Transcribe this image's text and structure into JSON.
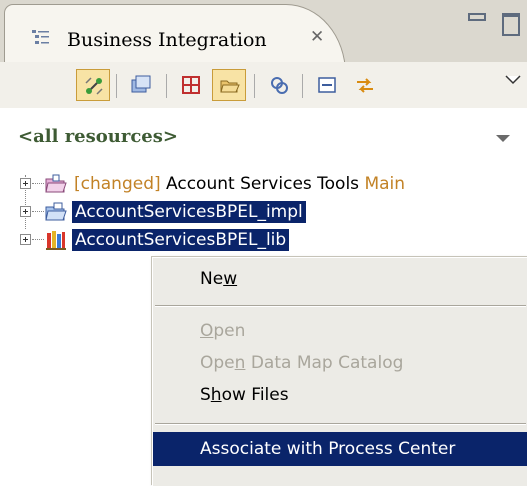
{
  "view": {
    "tab_title": "Business Integration",
    "close_glyph": "✕"
  },
  "toolbar": {
    "buttons": [
      {
        "icon": "link-editor-icon",
        "active": true
      },
      {
        "icon": "collapse-all-icon",
        "active": false
      },
      {
        "icon": "show-categories-icon",
        "active": false
      },
      {
        "icon": "open-folder-icon",
        "active": true
      },
      {
        "icon": "process-center-icon",
        "active": false
      },
      {
        "icon": "minimize-view-icon",
        "active": false
      },
      {
        "icon": "sync-icon",
        "active": false
      }
    ]
  },
  "filter": {
    "value": "<all resources>"
  },
  "tree": {
    "items": [
      {
        "prefix": "[changed]",
        "label": " Account Services Tools ",
        "suffix": "Main",
        "icon": "project-changed-icon",
        "selected": false
      },
      {
        "label": "AccountServicesBPEL_impl",
        "icon": "module-icon",
        "selected": true
      },
      {
        "label": "AccountServicesBPEL_lib",
        "icon": "library-icon",
        "selected": true
      }
    ]
  },
  "context_menu": {
    "items": [
      {
        "label": "New",
        "mnemonic": "w",
        "enabled": true
      },
      {
        "label": "Open",
        "mnemonic": "O",
        "enabled": false
      },
      {
        "label": "Open Data Map Catalog",
        "mnemonic": "n",
        "enabled": false
      },
      {
        "label": "Show Files",
        "mnemonic": "h",
        "enabled": true
      },
      {
        "label": "Associate with Process Center",
        "enabled": true,
        "highlighted": true
      }
    ]
  },
  "colors": {
    "selection": "#0a246a",
    "changed_text": "#c28226",
    "filter_text": "#3e5b34",
    "active_button": "#f8e3a5"
  }
}
